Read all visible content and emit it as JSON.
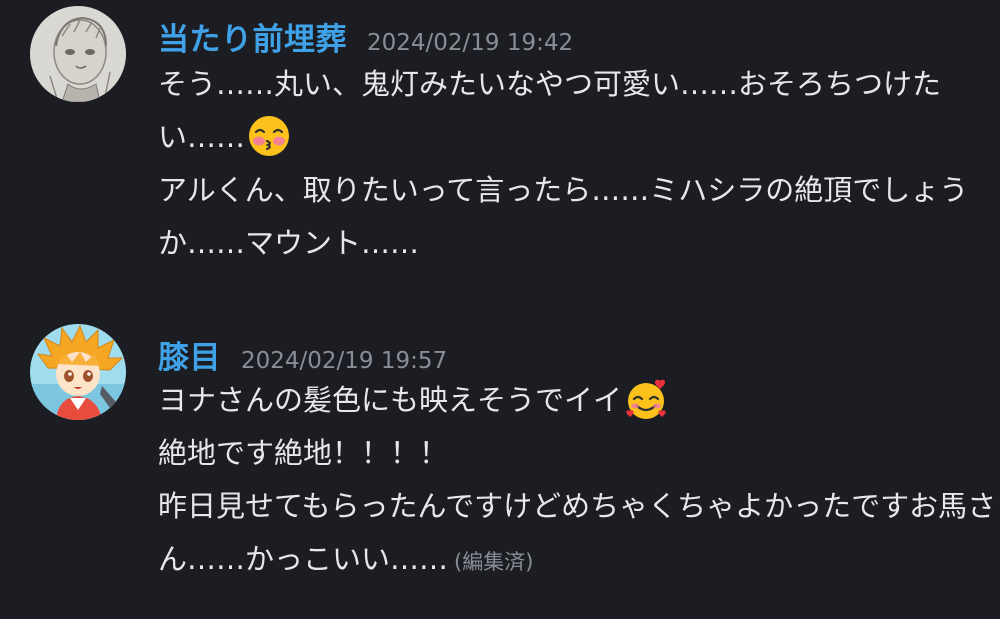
{
  "messages": [
    {
      "username": "当たり前埋葬",
      "timestamp": "2024/02/19 19:42",
      "lines": [
        "そう……丸い、鬼灯みたいなやつ可愛い……おそろちつけた",
        "い……",
        "アルくん、取りたいって言ったら……ミハシラの絶頂でしょう",
        "か……マウント……"
      ],
      "emoji": "kissing-face-with-closed-eyes-emoji"
    },
    {
      "username": "膝目",
      "timestamp": "2024/02/19 19:57",
      "lines": [
        "ヨナさんの髪色にも映えそうでイイ",
        "絶地です絶地！！！！",
        "昨日見せてもらったんですけどめちゃくちゃよかったですお馬さ",
        "ん……かっこいい……"
      ],
      "edited": "(編集済)",
      "emoji": "smiling-face-with-hearts-emoji"
    }
  ]
}
